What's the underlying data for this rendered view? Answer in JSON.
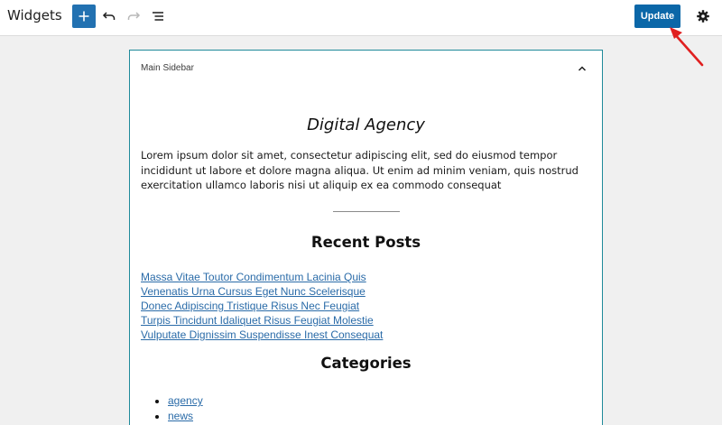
{
  "header": {
    "title": "Widgets",
    "update_label": "Update"
  },
  "icons": {
    "add": "plus-icon",
    "undo": "undo-icon",
    "redo": "redo-icon",
    "list_view": "list-view-icon",
    "settings": "gear-icon",
    "collapse": "chevron-up-icon",
    "annotation": "red-arrow-icon"
  },
  "colors": {
    "accent": "#2271b1",
    "update_button": "#0b67a8",
    "panel_border": "#1f8a9a",
    "link": "#2a6ba8",
    "annotation_arrow": "#e02020"
  },
  "sidebar": {
    "title": "Main Sidebar",
    "heading": "Digital Agency",
    "paragraph": "Lorem ipsum dolor sit amet, consectetur adipiscing elit, sed do eiusmod tempor incididunt ut labore et dolore magna aliqua. Ut enim ad minim veniam, quis nostrud exercitation ullamco laboris nisi ut aliquip ex ea commodo consequat",
    "recent_posts": {
      "heading": "Recent Posts",
      "items": [
        "Massa Vitae Toutor Condimentum Lacinia Quis",
        "Venenatis Urna Cursus Eget Nunc Scelerisque",
        "Donec Adipiscing Tristique Risus Nec Feugiat",
        "Turpis Tincidunt Idaliquet Risus Feugiat Molestie",
        "Vulputate Dignissim Suspendisse Inest Consequat"
      ]
    },
    "categories": {
      "heading": "Categories",
      "items": [
        "agency",
        "news"
      ]
    }
  }
}
